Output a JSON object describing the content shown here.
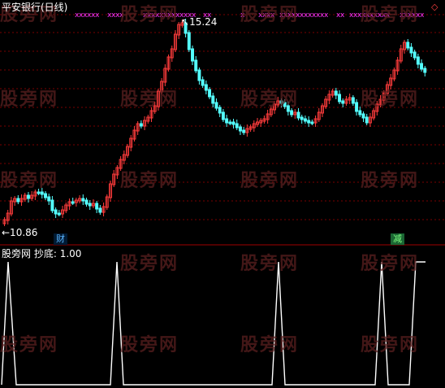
{
  "main_chart": {
    "title": "平安银行(日线)",
    "high_label": "15.24",
    "low_label": "←10.86",
    "marker_left": "财",
    "marker_right": "减",
    "signal_glyph": "x",
    "colors": {
      "up": "#ff3c3c",
      "down": "#54ffff",
      "grid": "#7a0000",
      "title": "#ffffff",
      "signal": "#ff33ff",
      "divider": "#a00000"
    }
  },
  "indicator": {
    "title": "股旁网 抄底:",
    "value": "1.00",
    "line_color": "#ffffff"
  },
  "corner_icon": "diamond-outline-icon",
  "watermark": "股旁网"
}
